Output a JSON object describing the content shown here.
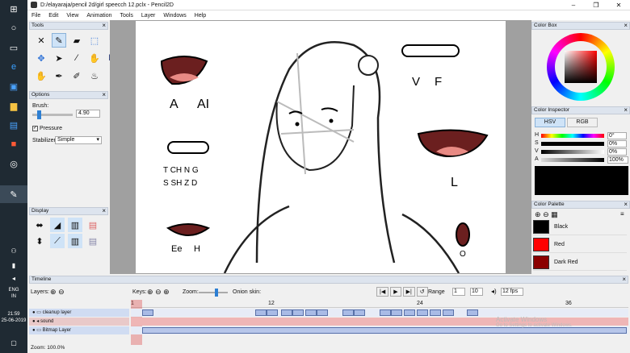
{
  "taskbar": {
    "time": "21:59",
    "date": "25-06-2019",
    "lang": "ENG",
    "region": "IN"
  },
  "window": {
    "title": "D:/elayaraja/pencil 2d/girl speecch 12.pclx - Pencil2D"
  },
  "menu": [
    "File",
    "Edit",
    "View",
    "Animation",
    "Tools",
    "Layer",
    "Windows",
    "Help"
  ],
  "tools_panel": {
    "title": "Tools"
  },
  "options_panel": {
    "title": "Options",
    "brush_label": "Brush:",
    "brush_value": "4.90",
    "pressure_label": "Pressure",
    "stabilizer_label": "Stabilizer",
    "stabilizer_value": "Simple"
  },
  "display_panel": {
    "title": "Display"
  },
  "canvas": {
    "labels": [
      "A",
      "AI",
      "V",
      "F",
      "T  CH  N  G",
      "S  SH  Z  D",
      "L",
      "Ee",
      "H",
      "O"
    ]
  },
  "color_box": {
    "title": "Color Box"
  },
  "color_inspector": {
    "title": "Color Inspector",
    "tab_hsv": "HSV",
    "tab_rgb": "RGB",
    "rows": [
      {
        "label": "H",
        "value": "0°"
      },
      {
        "label": "S",
        "value": "0%"
      },
      {
        "label": "V",
        "value": "0%"
      },
      {
        "label": "A",
        "value": "100%"
      }
    ]
  },
  "color_palette": {
    "title": "Color Palette",
    "colors": [
      {
        "name": "Black",
        "hex": "#000000"
      },
      {
        "name": "Red",
        "hex": "#ff0000"
      },
      {
        "name": "Dark Red",
        "hex": "#8b0000"
      }
    ]
  },
  "timeline": {
    "title": "Timeline",
    "layers_label": "Layers:",
    "keys_label": "Keys:",
    "zoom_label": "Zoom:",
    "onion_label": "Onion skin:",
    "range_label": "Range",
    "range_start": "1",
    "range_end": "10",
    "fps": "12 fps",
    "ruler": [
      "1",
      "12",
      "24",
      "36"
    ],
    "layers": [
      {
        "name": "cleanup layer"
      },
      {
        "name": "sound"
      },
      {
        "name": "Bitmap Layer"
      }
    ],
    "watermark_line1": "Activate Windows",
    "watermark_line2": "Go to Settings to activate Windows."
  },
  "status": {
    "zoom": "Zoom: 100.0%"
  }
}
